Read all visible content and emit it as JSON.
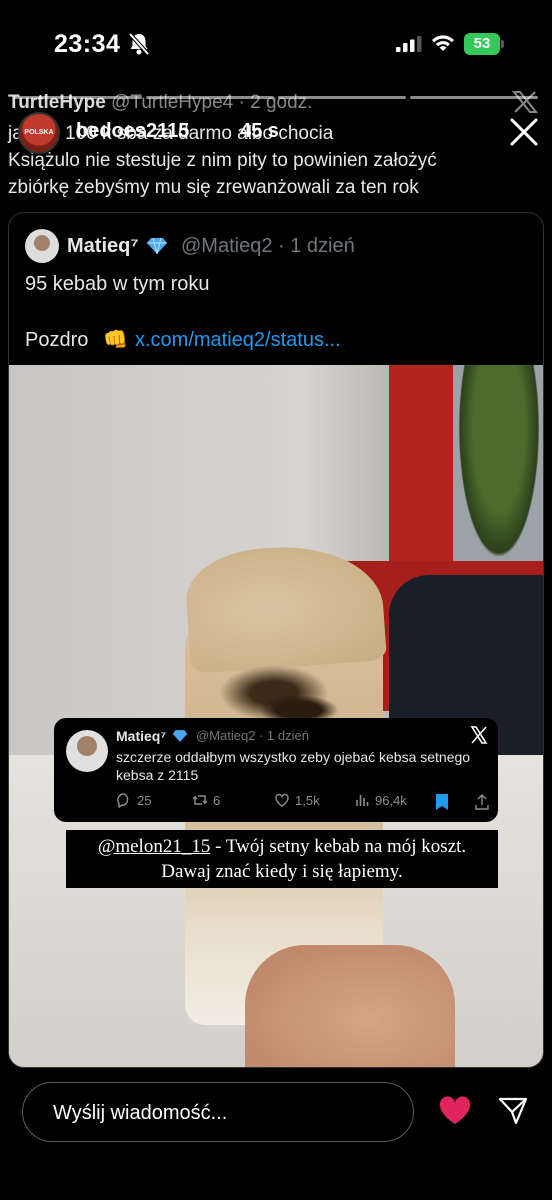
{
  "status_bar": {
    "time": "23:34",
    "battery": "53"
  },
  "background_tweet": {
    "author": "TurtleHype",
    "handle": "@TurtleHype4",
    "age": "2 godz.",
    "text_line1": "ja   n  m        100 k  sba za darmo albo chocia",
    "text_line2": "Książulo nie stestuje z nim pity to powinien założyć",
    "text_line3": "zbiórkę żebyśmy mu się zrewanżowali za ten rok"
  },
  "story": {
    "username": "bedoes2115",
    "age": "45 s",
    "avatar_text": "POLSKA"
  },
  "quoted_tweet": {
    "author": "Matieq⁷",
    "handle": "@Matieq2 · 1 dzień",
    "line1": "95 kebab w tym roku",
    "line2": "Pozdro",
    "fist": "👊",
    "link": "x.com/matieq2/status..."
  },
  "sticker_tweet": {
    "author": "Matieq⁷",
    "handle": "@Matieq2 · 1 dzień",
    "text": "szczerze oddałbym wszystko zeby ojebać kebsa setnego kebsa z 2115",
    "replies": "25",
    "retweets": "6",
    "likes": "1,5k",
    "views": "96,4k"
  },
  "caption": {
    "mention": "@melon21_15",
    "line1_rest": " - Twój setny kebab na mój koszt.",
    "line2": "Dawaj znać kiedy i się łapiemy."
  },
  "bottom_bar": {
    "message_placeholder": "Wyślij wiadomość..."
  },
  "colors": {
    "like": "#e0245e",
    "link": "#1d9bf0",
    "bookmark": "#1d9bf0",
    "battery": "#34c759"
  }
}
